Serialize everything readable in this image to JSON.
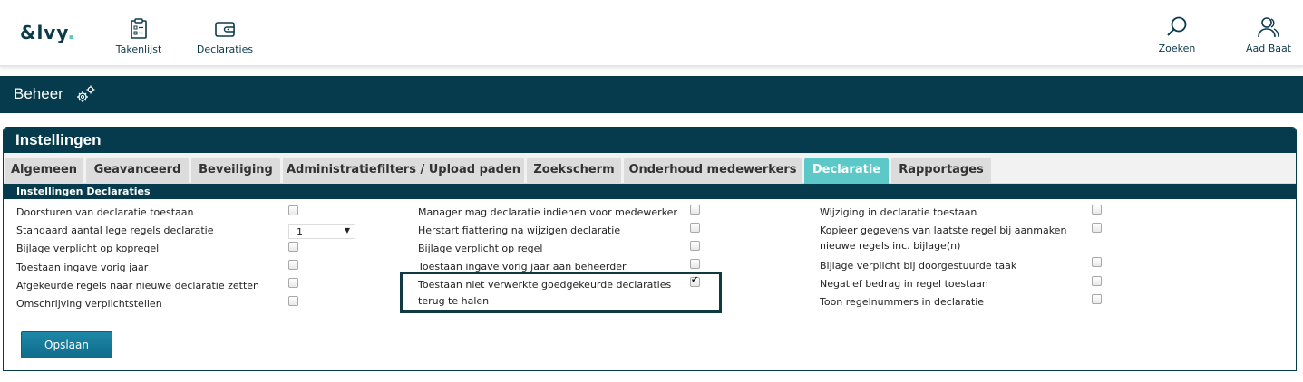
{
  "app": {
    "logo_text": "&lvy",
    "logo_dot": "."
  },
  "nav": {
    "takenlijst": "Takenlijst",
    "declaraties": "Declaraties",
    "zoeken": "Zoeken",
    "user": "Aad Baat"
  },
  "banner": {
    "title": "Beheer"
  },
  "panel": {
    "title": "Instellingen"
  },
  "tabs": [
    {
      "label": "Algemeen"
    },
    {
      "label": "Geavanceerd"
    },
    {
      "label": "Beveiliging"
    },
    {
      "label": "Administratiefilters / Upload paden"
    },
    {
      "label": "Zoekscherm"
    },
    {
      "label": "Onderhoud medewerkers"
    },
    {
      "label": "Declaratie"
    },
    {
      "label": "Rapportages"
    }
  ],
  "active_tab": "Declaratie",
  "section": {
    "title": "Instellingen Declaraties"
  },
  "settings": {
    "col1": [
      {
        "label": "Doorsturen van declaratie toestaan",
        "checked": false
      },
      {
        "label": "Standaard aantal lege regels declaratie",
        "select_value": "1"
      },
      {
        "label": "Bijlage verplicht op kopregel",
        "checked": false
      },
      {
        "label": "Toestaan ingave vorig jaar",
        "checked": false
      },
      {
        "label": "Afgekeurde regels naar nieuwe declaratie zetten",
        "checked": false
      },
      {
        "label": "Omschrijving verplichtstellen",
        "checked": false
      }
    ],
    "col2": [
      {
        "label": "Manager mag declaratie indienen voor medewerker",
        "checked": false
      },
      {
        "label": "Herstart fiattering na wijzigen declaratie",
        "checked": false
      },
      {
        "label": "Bijlage verplicht op regel",
        "checked": false
      },
      {
        "label": "Toestaan ingave vorig jaar aan beheerder",
        "checked": false
      },
      {
        "label_line1": "Toestaan niet verwerkte goedgekeurde declaraties",
        "label_line2": "terug te halen",
        "checked": true
      }
    ],
    "col3": [
      {
        "label": "Wijziging in declaratie toestaan",
        "checked": false
      },
      {
        "label_line1": "Kopieer gegevens van laatste regel bij aanmaken",
        "label_line2": "nieuwe regels inc. bijlage(n)",
        "checked": false
      },
      {
        "label": "Bijlage verplicht bij doorgestuurde taak",
        "checked": false
      },
      {
        "label": "Negatief bedrag in regel toestaan",
        "checked": false
      },
      {
        "label": "Toon regelnummers in declaratie",
        "checked": false
      }
    ]
  },
  "actions": {
    "save_label": "Opslaan"
  },
  "colors": {
    "primary_dark": "#053b4c",
    "accent": "#5cc8c8",
    "button": "#1a7fa0"
  }
}
